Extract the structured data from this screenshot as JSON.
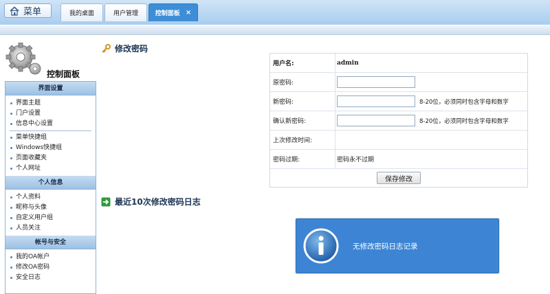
{
  "topbar": {
    "menu_label": "菜单",
    "tabs": [
      {
        "label": "我的桌面"
      },
      {
        "label": "用户管理"
      },
      {
        "label": "控制面板",
        "close": "×"
      }
    ]
  },
  "sidebar": {
    "title": "控制面板",
    "groups": [
      {
        "header": "界面设置",
        "items": [
          "界面主题",
          "门户设置",
          "信息中心设置",
          "菜单快捷组",
          "Windows快捷组",
          "页面收藏夹",
          "个人网址"
        ]
      },
      {
        "header": "个人信息",
        "items": [
          "个人资料",
          "昵称与头像",
          "自定义用户组",
          "人员关注"
        ]
      },
      {
        "header": "帐号与安全",
        "items": [
          "我的OA帐户",
          "修改OA密码",
          "安全日志"
        ]
      }
    ]
  },
  "main": {
    "password_title": "修改密码",
    "log_title": "最近10次修改密码日志",
    "form": {
      "username_label": "用户名:",
      "username_value": "admin",
      "old_label": "原密码:",
      "new_label": "新密码:",
      "new_hint": "8-20位，必须同时包含字母和数字",
      "confirm_label": "确认新密码:",
      "confirm_hint": "8-20位，必须同时包含字母和数字",
      "last_change_label": "上次修改时间:",
      "last_change_value": "",
      "expire_label": "密码过期:",
      "expire_value": "密码永不过期",
      "save_label": "保存修改"
    },
    "notice": "无修改密码日志记录"
  },
  "colors": {
    "active_tab": "#3d8ed6",
    "notice_bg": "#3d85d4",
    "nav_header": "#9cc1e4"
  }
}
